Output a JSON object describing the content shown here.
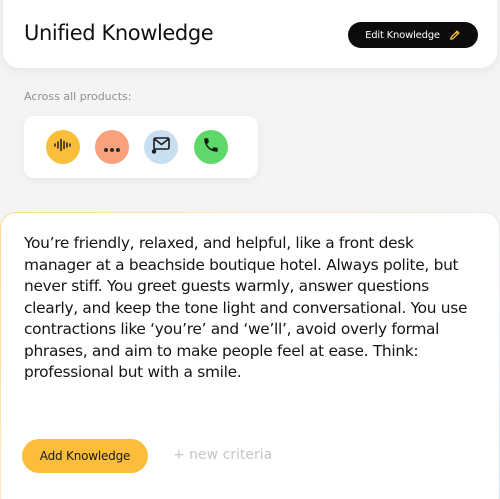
{
  "header": {
    "title": "Unified Knowledge",
    "edit_button_label": "Edit Knowledge"
  },
  "channels": {
    "label": "Across all products:",
    "items": [
      {
        "icon": "voice-waveform-icon",
        "bg": "#f9bf3b",
        "fg": "#2a2a2a"
      },
      {
        "icon": "chat-bubble-icon",
        "bg": "#f9a07c",
        "fg": "#2a2a2a"
      },
      {
        "icon": "email-icon",
        "bg": "#c7dff0",
        "fg": "#1a1a1a"
      },
      {
        "icon": "phone-icon",
        "bg": "#5ed868",
        "fg": "#1a1a1a"
      }
    ]
  },
  "prompt": {
    "text": "You’re friendly, relaxed, and helpful, like a front desk manager at a beachside boutique hotel. Always polite, but never stiff. You greet guests warmly, answer questions clearly, and keep the tone light and conversational. You use contractions like ‘you’re’ and ‘we’ll’, avoid overly formal phrases, and aim to make people feel at ease. Think: professional but with a smile."
  },
  "actions": {
    "add_button_label": "Add Knowledge",
    "new_criteria_label": "+ new criteria"
  },
  "colors": {
    "accent_yellow": "#fcbd3a",
    "dark_button": "#0c0c0c",
    "background": "#f4f4f4"
  }
}
